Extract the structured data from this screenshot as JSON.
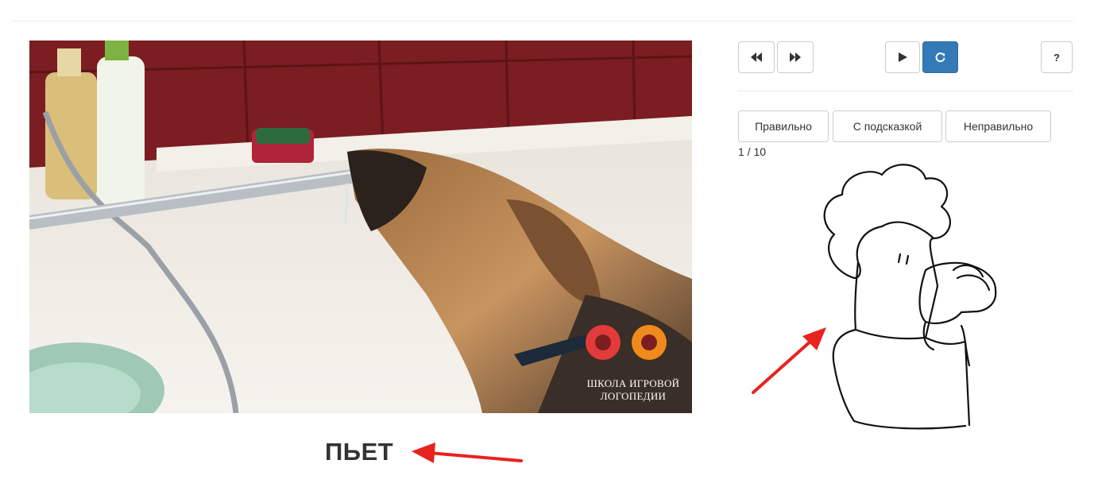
{
  "controls": {
    "rewind_icon": "rewind-icon",
    "forward_icon": "fast-forward-icon",
    "play_icon": "play-icon",
    "repeat_icon": "repeat-icon",
    "help_label": "?"
  },
  "answers": {
    "correct": "Правильно",
    "hint": "С подсказкой",
    "wrong": "Неправильно"
  },
  "progress": {
    "counter": "1 / 10",
    "current": 1,
    "total": 10
  },
  "video": {
    "watermark_line1": "ШКОЛА ИГРОВОЙ",
    "watermark_line2": "ЛОГОПЕДИИ"
  },
  "word": "ПЬЕТ",
  "colors": {
    "primary": "#337ab7",
    "annotation_arrow": "#e8231f",
    "logo_red": "#e23b3b",
    "logo_orange": "#f08a1c"
  }
}
